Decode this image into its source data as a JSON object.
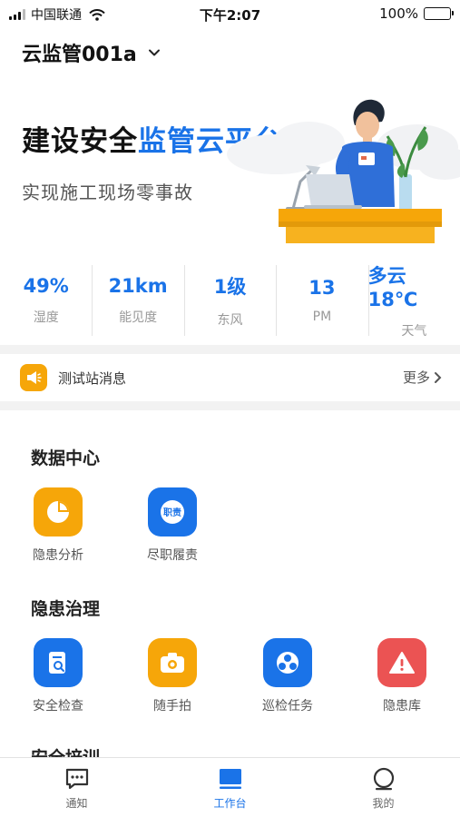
{
  "status_bar": {
    "carrier": "中国联通",
    "time": "下午2:07",
    "battery": "100%"
  },
  "header": {
    "project_name": "云监管001a",
    "chevron_icon": "chevron-down-icon"
  },
  "banner": {
    "title_main": "建设安全",
    "title_accent": "监管云平台",
    "subtitle": "实现施工现场零事故",
    "illustration": "worker-at-desk-illustration"
  },
  "weather": [
    {
      "value": "49%",
      "label": "湿度"
    },
    {
      "value": "21km",
      "label": "能见度"
    },
    {
      "value": "1级",
      "label": "东风"
    },
    {
      "value": "13",
      "label": "PM"
    },
    {
      "value": "多云 18℃",
      "label": "天气"
    }
  ],
  "notice": {
    "icon": "megaphone-icon",
    "text": "测试站消息",
    "more_label": "更多"
  },
  "sections": {
    "data_center": {
      "title": "数据中心",
      "items": [
        {
          "label": "隐患分析",
          "icon": "pie-chart-icon",
          "color": "#f6a609"
        },
        {
          "label": "尽职履责",
          "icon": "duty-icon",
          "icon_text": "职责",
          "color": "#1a73e8"
        }
      ]
    },
    "hazard": {
      "title": "隐患治理",
      "items": [
        {
          "label": "安全检查",
          "icon": "inspection-icon",
          "color": "#1a73e8"
        },
        {
          "label": "随手拍",
          "icon": "camera-icon",
          "color": "#f6a609"
        },
        {
          "label": "巡检任务",
          "icon": "patrol-icon",
          "color": "#1a73e8"
        },
        {
          "label": "隐患库",
          "icon": "warning-icon",
          "color": "#eb5353"
        }
      ]
    },
    "training": {
      "title": "安全培训"
    }
  },
  "tab_bar": {
    "tabs": [
      {
        "label": "通知",
        "icon": "message-icon",
        "active": false
      },
      {
        "label": "工作台",
        "icon": "workbench-icon",
        "active": true
      },
      {
        "label": "我的",
        "icon": "profile-icon",
        "active": false
      }
    ],
    "active_color": "#1a73e8"
  }
}
